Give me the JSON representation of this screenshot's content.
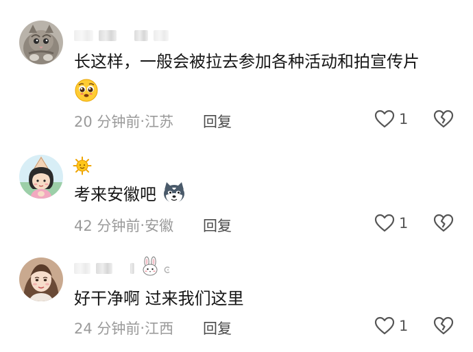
{
  "comments": [
    {
      "text": "长这样，一般会被拉去参加各种活动和拍宣传片",
      "time": "20 分钟前",
      "sep": " · ",
      "location": "江苏",
      "reply_label": "回复",
      "likes": "1",
      "avatar_icon": "kitten-avatar-icon",
      "emoji_icon": "pleading-face-icon"
    },
    {
      "text": "考来安徽吧",
      "time": "42 分钟前",
      "sep": " · ",
      "location": "安徽",
      "reply_label": "回复",
      "likes": "1",
      "avatar_icon": "cartoon-girl-avatar-icon",
      "badge_icon": "sun-icon",
      "emoji_icon": "husky-face-icon"
    },
    {
      "text": "好干净啊 过来我们这里",
      "time": "24 分钟前",
      "sep": " · ",
      "location": "江西",
      "reply_label": "回复",
      "likes": "1",
      "avatar_icon": "girl-photo-avatar-icon",
      "badge_icon": "bunny-icon"
    }
  ],
  "colors": {
    "text": "#161616",
    "meta": "#9a9a9a",
    "icon_stroke": "#555555"
  }
}
